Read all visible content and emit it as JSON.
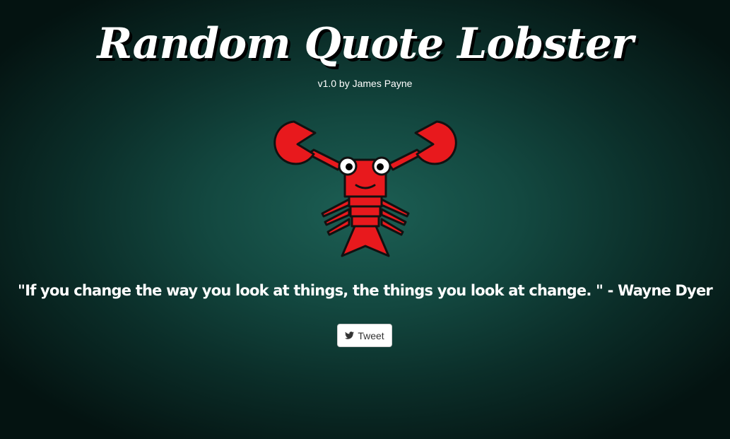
{
  "app": {
    "title": "Random Quote Lobster",
    "subtitle": "v1.0 by James Payne"
  },
  "mascot": {
    "icon": "lobster-icon",
    "colors": {
      "body": "#e8191d",
      "outline": "#111111",
      "eye_white": "#ffffff",
      "pupil": "#000000"
    }
  },
  "quote": {
    "text": "\"If you change the way you look at things, the things you look at change. \" - Wayne Dyer"
  },
  "actions": {
    "tweet_label": "Tweet",
    "tweet_icon": "twitter-bird-icon"
  },
  "theme": {
    "background_center": "#1c5f54",
    "background_edge": "#041311",
    "text": "#ffffff"
  }
}
